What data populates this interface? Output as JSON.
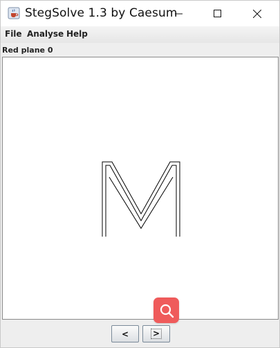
{
  "window": {
    "title": "StegSolve 1.3 by Caesum",
    "app_icon": "java-cup-icon"
  },
  "menu": {
    "items": [
      "File",
      "Analyse",
      "Help"
    ]
  },
  "view": {
    "plane_label": "Red plane 0",
    "image_content": "letter-M-outline"
  },
  "navigation": {
    "prev_label": "<",
    "next_label": ">"
  },
  "overlay": {
    "search_icon": "search-icon",
    "color": "#ef5b5b"
  }
}
